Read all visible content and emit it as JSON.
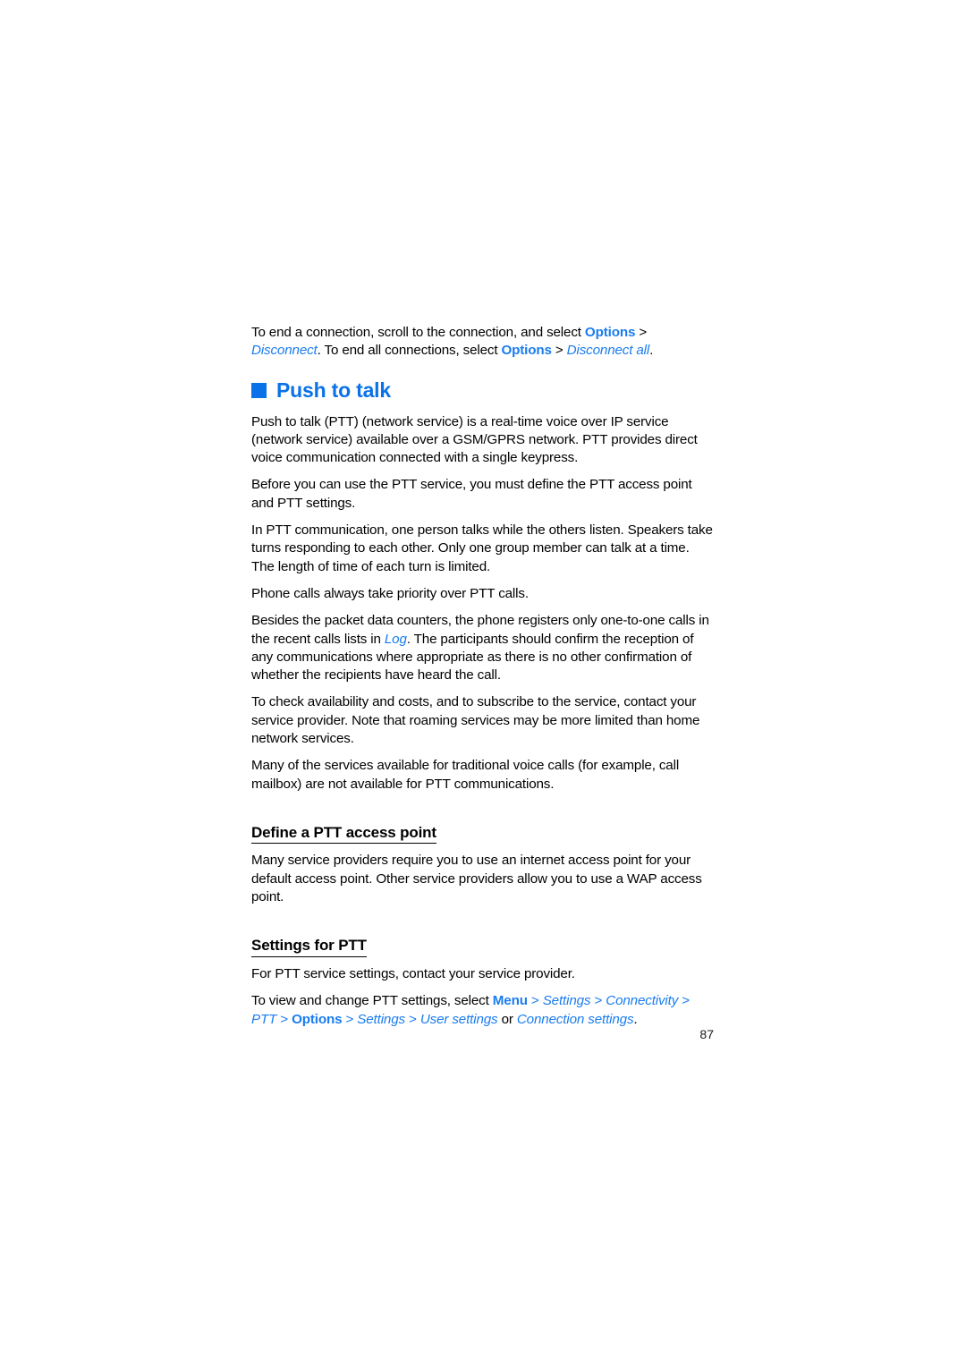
{
  "document": {
    "page_number": "87",
    "accent_color": "#0a72e8",
    "link_color": "#1a7cf0"
  },
  "intro_paragraph": {
    "part1": "To end a connection, scroll to the connection, and select ",
    "ui1": "Options",
    "sep1": " > ",
    "ui2": "Disconnect",
    "part2": ". To end all connections, select ",
    "ui3": "Options",
    "sep2": " > ",
    "ui4": "Disconnect all",
    "part3": "."
  },
  "chapter": {
    "bullet_icon": "blue-square-bullet-icon",
    "title": "Push to talk"
  },
  "paragraphs": [
    "Push to talk (PTT) (network service) is a real-time voice over IP service (network service) available over a GSM/GPRS network. PTT provides direct voice communication connected with a single keypress.",
    "Before you can use the PTT service, you must define the PTT access point and PTT settings.",
    "In PTT communication, one person talks while the others listen. Speakers take turns responding to each other. Only one group member can talk at a time. The length of time of each turn is limited.",
    "Phone calls always take priority over PTT calls."
  ],
  "log_paragraph": {
    "part1": "Besides the packet data counters, the phone registers only one-to-one calls in the recent calls lists in ",
    "ui1": "Log",
    "part2": ". The participants should confirm the reception of any communications where appropriate as there is no other confirmation of whether the recipients have heard the call."
  },
  "paragraphs_after": [
    "To check availability and costs, and to subscribe to the service, contact your service provider. Note that roaming services may be more limited than home network services.",
    "Many of the services available for traditional voice calls (for example, call mailbox) are not available for PTT communications."
  ],
  "section_access_point": {
    "heading": "Define a PTT access point",
    "body": "Many service providers require you to use an internet access point for your default access point. Other service providers allow you to use a WAP access point."
  },
  "section_settings": {
    "heading": "Settings for PTT",
    "body": "For PTT service settings, contact your service provider.",
    "path_paragraph": {
      "part1": "To view and change PTT settings, select ",
      "ui1": "Menu",
      "sep1": " > ",
      "ui2": "Settings",
      "sep2": " > ",
      "ui3": "Connectivity",
      "sep3": " > ",
      "ui4": "PTT",
      "sep4": " > ",
      "ui5": "Options",
      "sep5": " > ",
      "ui6": "Settings",
      "sep6": " > ",
      "ui7": "User settings",
      "joiner": " or ",
      "ui8": "Connection settings",
      "end": "."
    }
  }
}
